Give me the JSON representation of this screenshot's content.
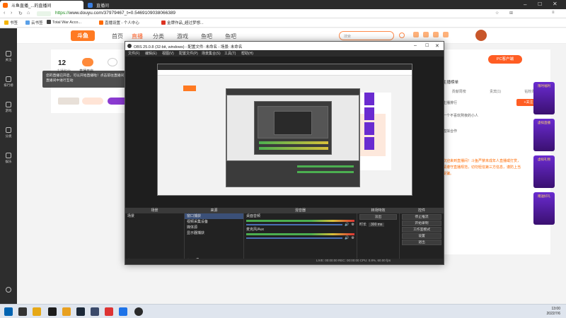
{
  "browser": {
    "tabs": [
      {
        "label": "直播间"
      },
      {
        "label": "斗鱼直播_...的直播间"
      }
    ],
    "url_scheme": "https://",
    "url_rest": "www.douyu.com/37979467_t=0.5469109038066389",
    "bookmarks": [
      "书签",
      "云书签",
      "Total War Acco...",
      "直播设置 - 个人中心",
      "金牌作品_超过梦想..."
    ]
  },
  "douyu": {
    "logo": "斗鱼",
    "nav": [
      "首页",
      "直播",
      "分类",
      "游戏",
      "鱼吧"
    ],
    "search_placeholder": "搜索",
    "rail": [
      "关注",
      "排行榜",
      "游戏",
      "分类",
      "娱乐"
    ],
    "anchor": {
      "count": "12",
      "count_label": "主播积分",
      "tag1": "直播开启",
      "tag2": "..."
    },
    "tooltip": "您的直播已开启，可以开始直播啦！点击前往直播间，主播可以在直播间中进行互动",
    "right_tabs": [
      "主播榜单",
      "贡献周榜",
      "贵宾(1)",
      "钻粉贡献"
    ],
    "right_items": [
      "主播排行",
      "一个不喜欢熬夜的小人",
      "虚拟合作"
    ],
    "pc_tag": "PC客户端",
    "follow_btn": "+关注",
    "promo": [
      "限时福利",
      "虚拟直播",
      "虚拟礼物",
      "赠送好礼"
    ],
    "orange_text": "欢迎来到直播间！斗鱼严禁未成年人直播或打赏，请遵守直播规范，切勿轻信第三方信息，谨防上当受骗。"
  },
  "obs": {
    "title": "OBS 25.0.8 (32-bit, windows) - 配置文件: 未命名 - 场景: 未命名",
    "menu": [
      "文件(F)",
      "编辑(E)",
      "视图(V)",
      "配置文件(P)",
      "场景集合(S)",
      "工具(T)",
      "帮助(H)"
    ],
    "docks": {
      "scenes": {
        "header": "场景",
        "items": [
          "场景"
        ]
      },
      "sources": {
        "header": "来源",
        "items": [
          "窗口捕获",
          "视频采集设备",
          "媒体源",
          "显示器捕获"
        ]
      },
      "mixer": {
        "header": "混音器",
        "tracks": [
          "桌面音频",
          "麦克风/Aux"
        ],
        "values": [
          "0.0 dB",
          "0.0 dB"
        ]
      },
      "transitions": {
        "header": "转场特效",
        "type": "淡出",
        "duration_label": "时长",
        "duration": "300 ms"
      },
      "controls": {
        "header": "控件",
        "buttons": [
          "停止推流",
          "开始录制",
          "工作室模式",
          "设置",
          "退出"
        ]
      }
    },
    "status": "LIVE: 00:00:00   REC: 00:00:00   CPU: 0.8%, 60.00 fps"
  },
  "taskbar": {
    "time": "13:00",
    "date": "2022/7/6"
  }
}
